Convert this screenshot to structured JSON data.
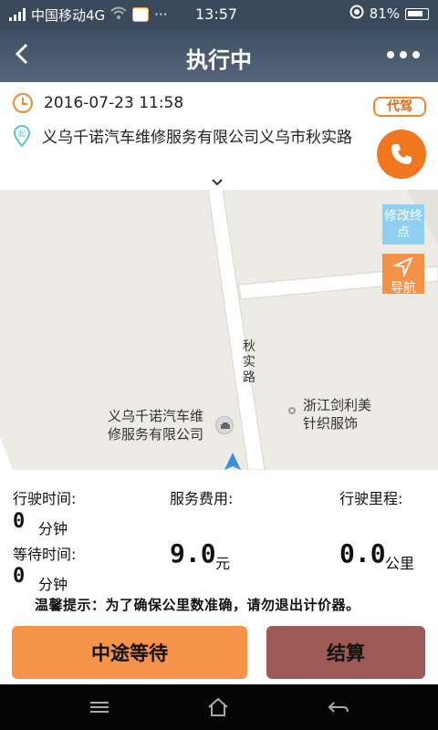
{
  "status_bar": {
    "carrier": "中国移动4G",
    "time": "13:57",
    "battery": "81%"
  },
  "header": {
    "title": "执行中"
  },
  "order": {
    "datetime": "2016-07-23 11:58",
    "location": "义乌千诺汽车维修服务有限公司义乌市秋实路",
    "tag": "代驾",
    "pin_letter": "起"
  },
  "map": {
    "edit_destination_label": "修改终点",
    "navigate_label": "导航",
    "poi_repair_shop": "义乌千诺汽车维修服务有限公司",
    "poi_textile": "浙江剑利美针织服饰",
    "road_name": "秋实路"
  },
  "stats": {
    "drive_time_label": "行驶时间:",
    "drive_time_value": "0",
    "drive_time_unit": "分钟",
    "wait_time_label": "等待时间:",
    "wait_time_value": "0",
    "wait_time_unit": "分钟",
    "fee_label": "服务费用:",
    "fee_value": "9.0",
    "fee_unit": "元",
    "distance_label": "行驶里程:",
    "distance_value": "0.0",
    "distance_unit": "公里",
    "tip": "温馨提示：为了确保公里数准确，请勿退出计价器。"
  },
  "actions": {
    "wait_label": "中途等待",
    "settle_label": "结算"
  },
  "colors": {
    "accent_orange": "#f0771e",
    "header_bg": "#3e5064",
    "edit_btn": "#8fd0f0",
    "settle_btn": "#9e5a57"
  }
}
